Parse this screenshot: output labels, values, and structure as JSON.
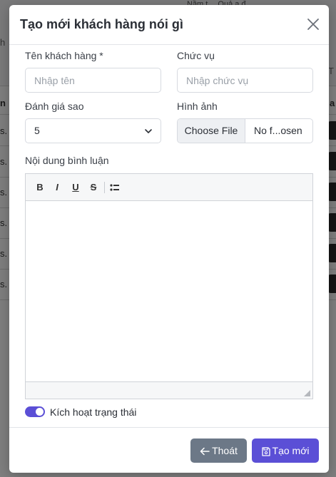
{
  "background": {
    "top_text": "Nầm t… Quả ạ đ..",
    "left_header": "h",
    "left_col_header": "n",
    "rows_left": [
      "s.",
      "s.",
      "s.",
      "s.",
      "s.",
      "s."
    ],
    "right_header": "T",
    "right_col_header": "a"
  },
  "modal": {
    "title": "Tạo mới khách hàng nói gì",
    "close_icon": "close-icon"
  },
  "form": {
    "name_label": "Tên khách hàng *",
    "name_placeholder": "Nhập tên",
    "position_label": "Chức vụ",
    "position_placeholder": "Nhập chức vụ",
    "rating_label": "Đánh giá sao",
    "rating_value": "5",
    "image_label": "Hình ảnh",
    "file_button": "Choose File",
    "file_name": "No f...osen",
    "content_label": "Nội dung bình luận",
    "toolbar": {
      "bold": "B",
      "italic": "I",
      "underline": "U",
      "strike": "S",
      "list_icon": "bullet-list-icon"
    },
    "status_label": "Kích hoạt trạng thái",
    "status_on": true
  },
  "footer": {
    "exit_label": "Thoát",
    "create_label": "Tạo mới",
    "exit_icon": "arrow-left-icon",
    "create_icon": "save-icon"
  },
  "colors": {
    "primary": "#5b4fd6",
    "secondary": "#6c7887"
  }
}
